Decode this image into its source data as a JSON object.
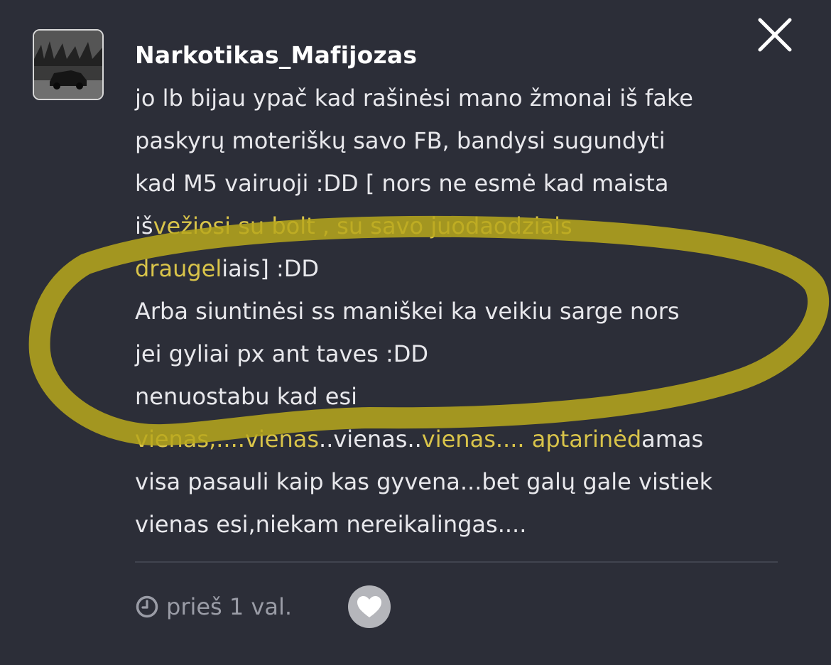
{
  "post": {
    "username": "Narkotikas_Mafijozas",
    "message_lines": [
      [
        {
          "t": "jo lb bijau ypač kad rašinėsi mano žmonai iš fake",
          "c": "w"
        }
      ],
      [
        {
          "t": "paskyrų moteriškų savo FB, bandysi sugundyti",
          "c": "w"
        }
      ],
      [
        {
          "t": "kad M5 vairuoji :DD [ nors ne esmė kad maista",
          "c": "w"
        }
      ],
      [
        {
          "t": "iš",
          "c": "w"
        },
        {
          "t": "vežiosi su bolt , su savo juodaodziais",
          "c": "y"
        }
      ],
      [
        {
          "t": "draugel",
          "c": "y"
        },
        {
          "t": "iais] :DD",
          "c": "w"
        }
      ],
      [
        {
          "t": "Arba siuntinėsi ss maniškei ka veikiu sarge nors",
          "c": "w"
        }
      ],
      [
        {
          "t": "jei gyliai px ant taves :DD",
          "c": "w"
        }
      ],
      [
        {
          "t": "nenuostabu kad esi",
          "c": "w"
        }
      ],
      [
        {
          "t": "vienas,....vienas",
          "c": "y"
        },
        {
          "t": "..vienas..",
          "c": "w"
        },
        {
          "t": "vienas.... aptarinėd",
          "c": "y"
        },
        {
          "t": "amas",
          "c": "w"
        }
      ],
      [
        {
          "t": "visa pasauli kaip kas gyvena...bet galų gale vistiek",
          "c": "w"
        }
      ],
      [
        {
          "t": "vienas esi,niekam nereikalingas....",
          "c": "w"
        }
      ]
    ],
    "timestamp": "prieš 1 val."
  },
  "icons": {
    "close": "close-icon",
    "clock": "clock-icon",
    "like": "heart-icon",
    "avatar": "avatar-car-photo"
  },
  "colors": {
    "background": "#2c2e38",
    "text": "#e8e8ec",
    "highlight_text": "#d9c44a",
    "highlight_ring": "#b8a81c",
    "muted": "#9a9ca6"
  }
}
